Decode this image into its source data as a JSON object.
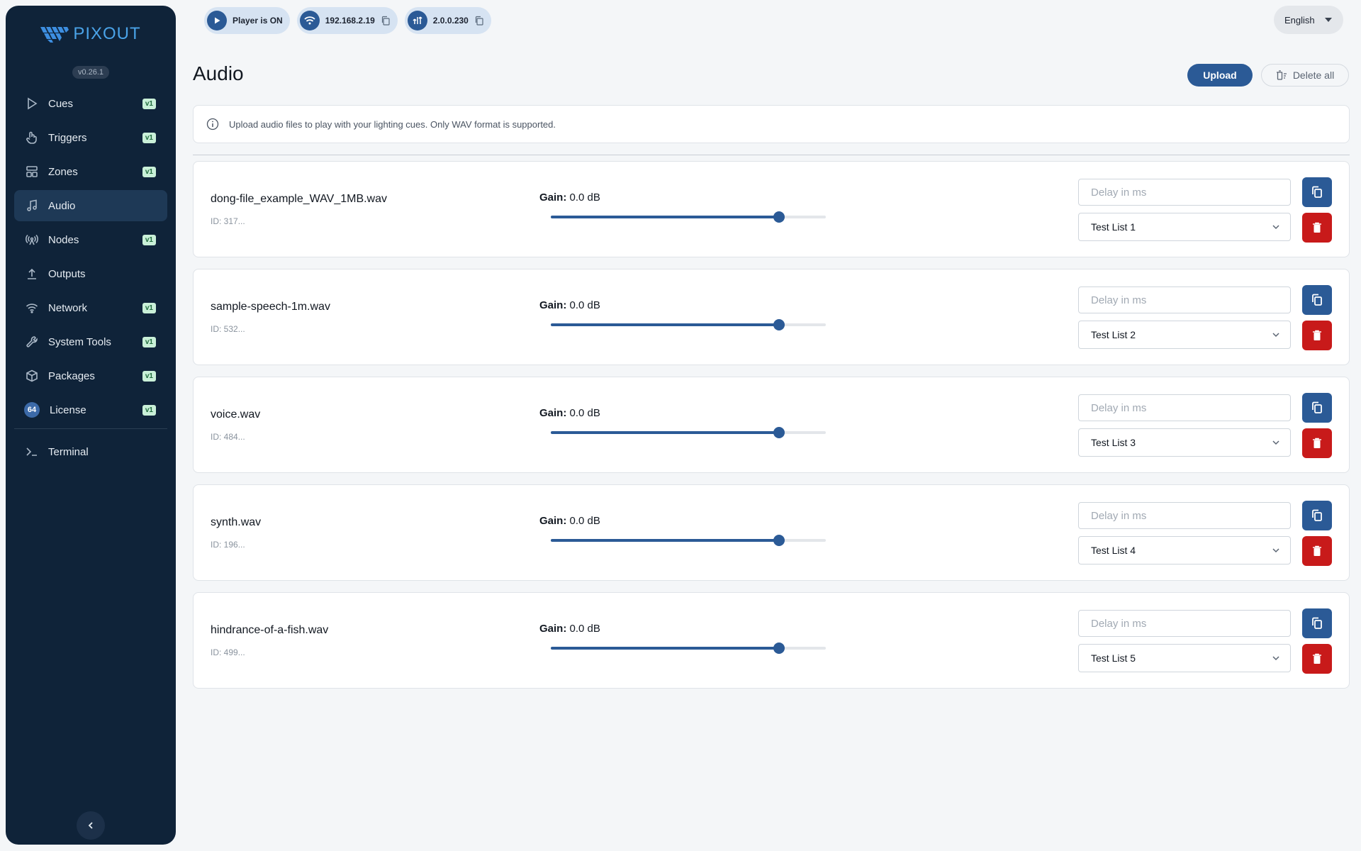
{
  "app": {
    "brand": "PIXOUT",
    "version": "v0.26.1"
  },
  "sidebar": {
    "items": [
      {
        "label": "Cues",
        "icon": "play-icon",
        "badge": "v1"
      },
      {
        "label": "Triggers",
        "icon": "hand-icon",
        "badge": "v1"
      },
      {
        "label": "Zones",
        "icon": "zones-icon",
        "badge": "v1"
      },
      {
        "label": "Audio",
        "icon": "music-note-icon",
        "badge": "",
        "active": true
      },
      {
        "label": "Nodes",
        "icon": "antenna-icon",
        "badge": "v1"
      },
      {
        "label": "Outputs",
        "icon": "upload-icon",
        "badge": ""
      },
      {
        "label": "Network",
        "icon": "wifi-icon",
        "badge": "v1"
      },
      {
        "label": "System Tools",
        "icon": "wrench-icon",
        "badge": "v1"
      },
      {
        "label": "Packages",
        "icon": "package-icon",
        "badge": "v1"
      },
      {
        "label": "License",
        "icon": "license-icon",
        "badge": "v1",
        "count": "64"
      }
    ],
    "terminal": {
      "label": "Terminal",
      "icon": "terminal-icon"
    }
  },
  "status": {
    "player": "Player is ON",
    "ip": "192.168.2.19",
    "firmware": "2.0.0.230"
  },
  "language": {
    "selected": "English"
  },
  "page": {
    "title": "Audio",
    "upload_label": "Upload",
    "delete_all_label": "Delete all",
    "info": "Upload audio files to play with your lighting cues. Only WAV format is supported."
  },
  "audio_files": [
    {
      "name": "dong-file_example_WAV_1MB.wav",
      "id": "ID: 317...",
      "gain_label": "Gain:",
      "gain_value": "0.0 dB",
      "gain_fraction": 0.83,
      "delay_placeholder": "Delay in ms",
      "list": "Test List 1"
    },
    {
      "name": "sample-speech-1m.wav",
      "id": "ID: 532...",
      "gain_label": "Gain:",
      "gain_value": "0.0 dB",
      "gain_fraction": 0.83,
      "delay_placeholder": "Delay in ms",
      "list": "Test List 2"
    },
    {
      "name": "voice.wav",
      "id": "ID: 484...",
      "gain_label": "Gain:",
      "gain_value": "0.0 dB",
      "gain_fraction": 0.83,
      "delay_placeholder": "Delay in ms",
      "list": "Test List 3"
    },
    {
      "name": "synth.wav",
      "id": "ID: 196...",
      "gain_label": "Gain:",
      "gain_value": "0.0 dB",
      "gain_fraction": 0.83,
      "delay_placeholder": "Delay in ms",
      "list": "Test List 4"
    },
    {
      "name": "hindrance-of-a-fish.wav",
      "id": "ID: 499...",
      "gain_label": "Gain:",
      "gain_value": "0.0 dB",
      "gain_fraction": 0.83,
      "delay_placeholder": "Delay in ms",
      "list": "Test List 5"
    }
  ],
  "colors": {
    "sidebar": "#0f2339",
    "primary": "#2b5a96",
    "danger": "#c81a1a",
    "badge_bg": "#c9f0d8",
    "badge_fg": "#1f6b3c"
  }
}
